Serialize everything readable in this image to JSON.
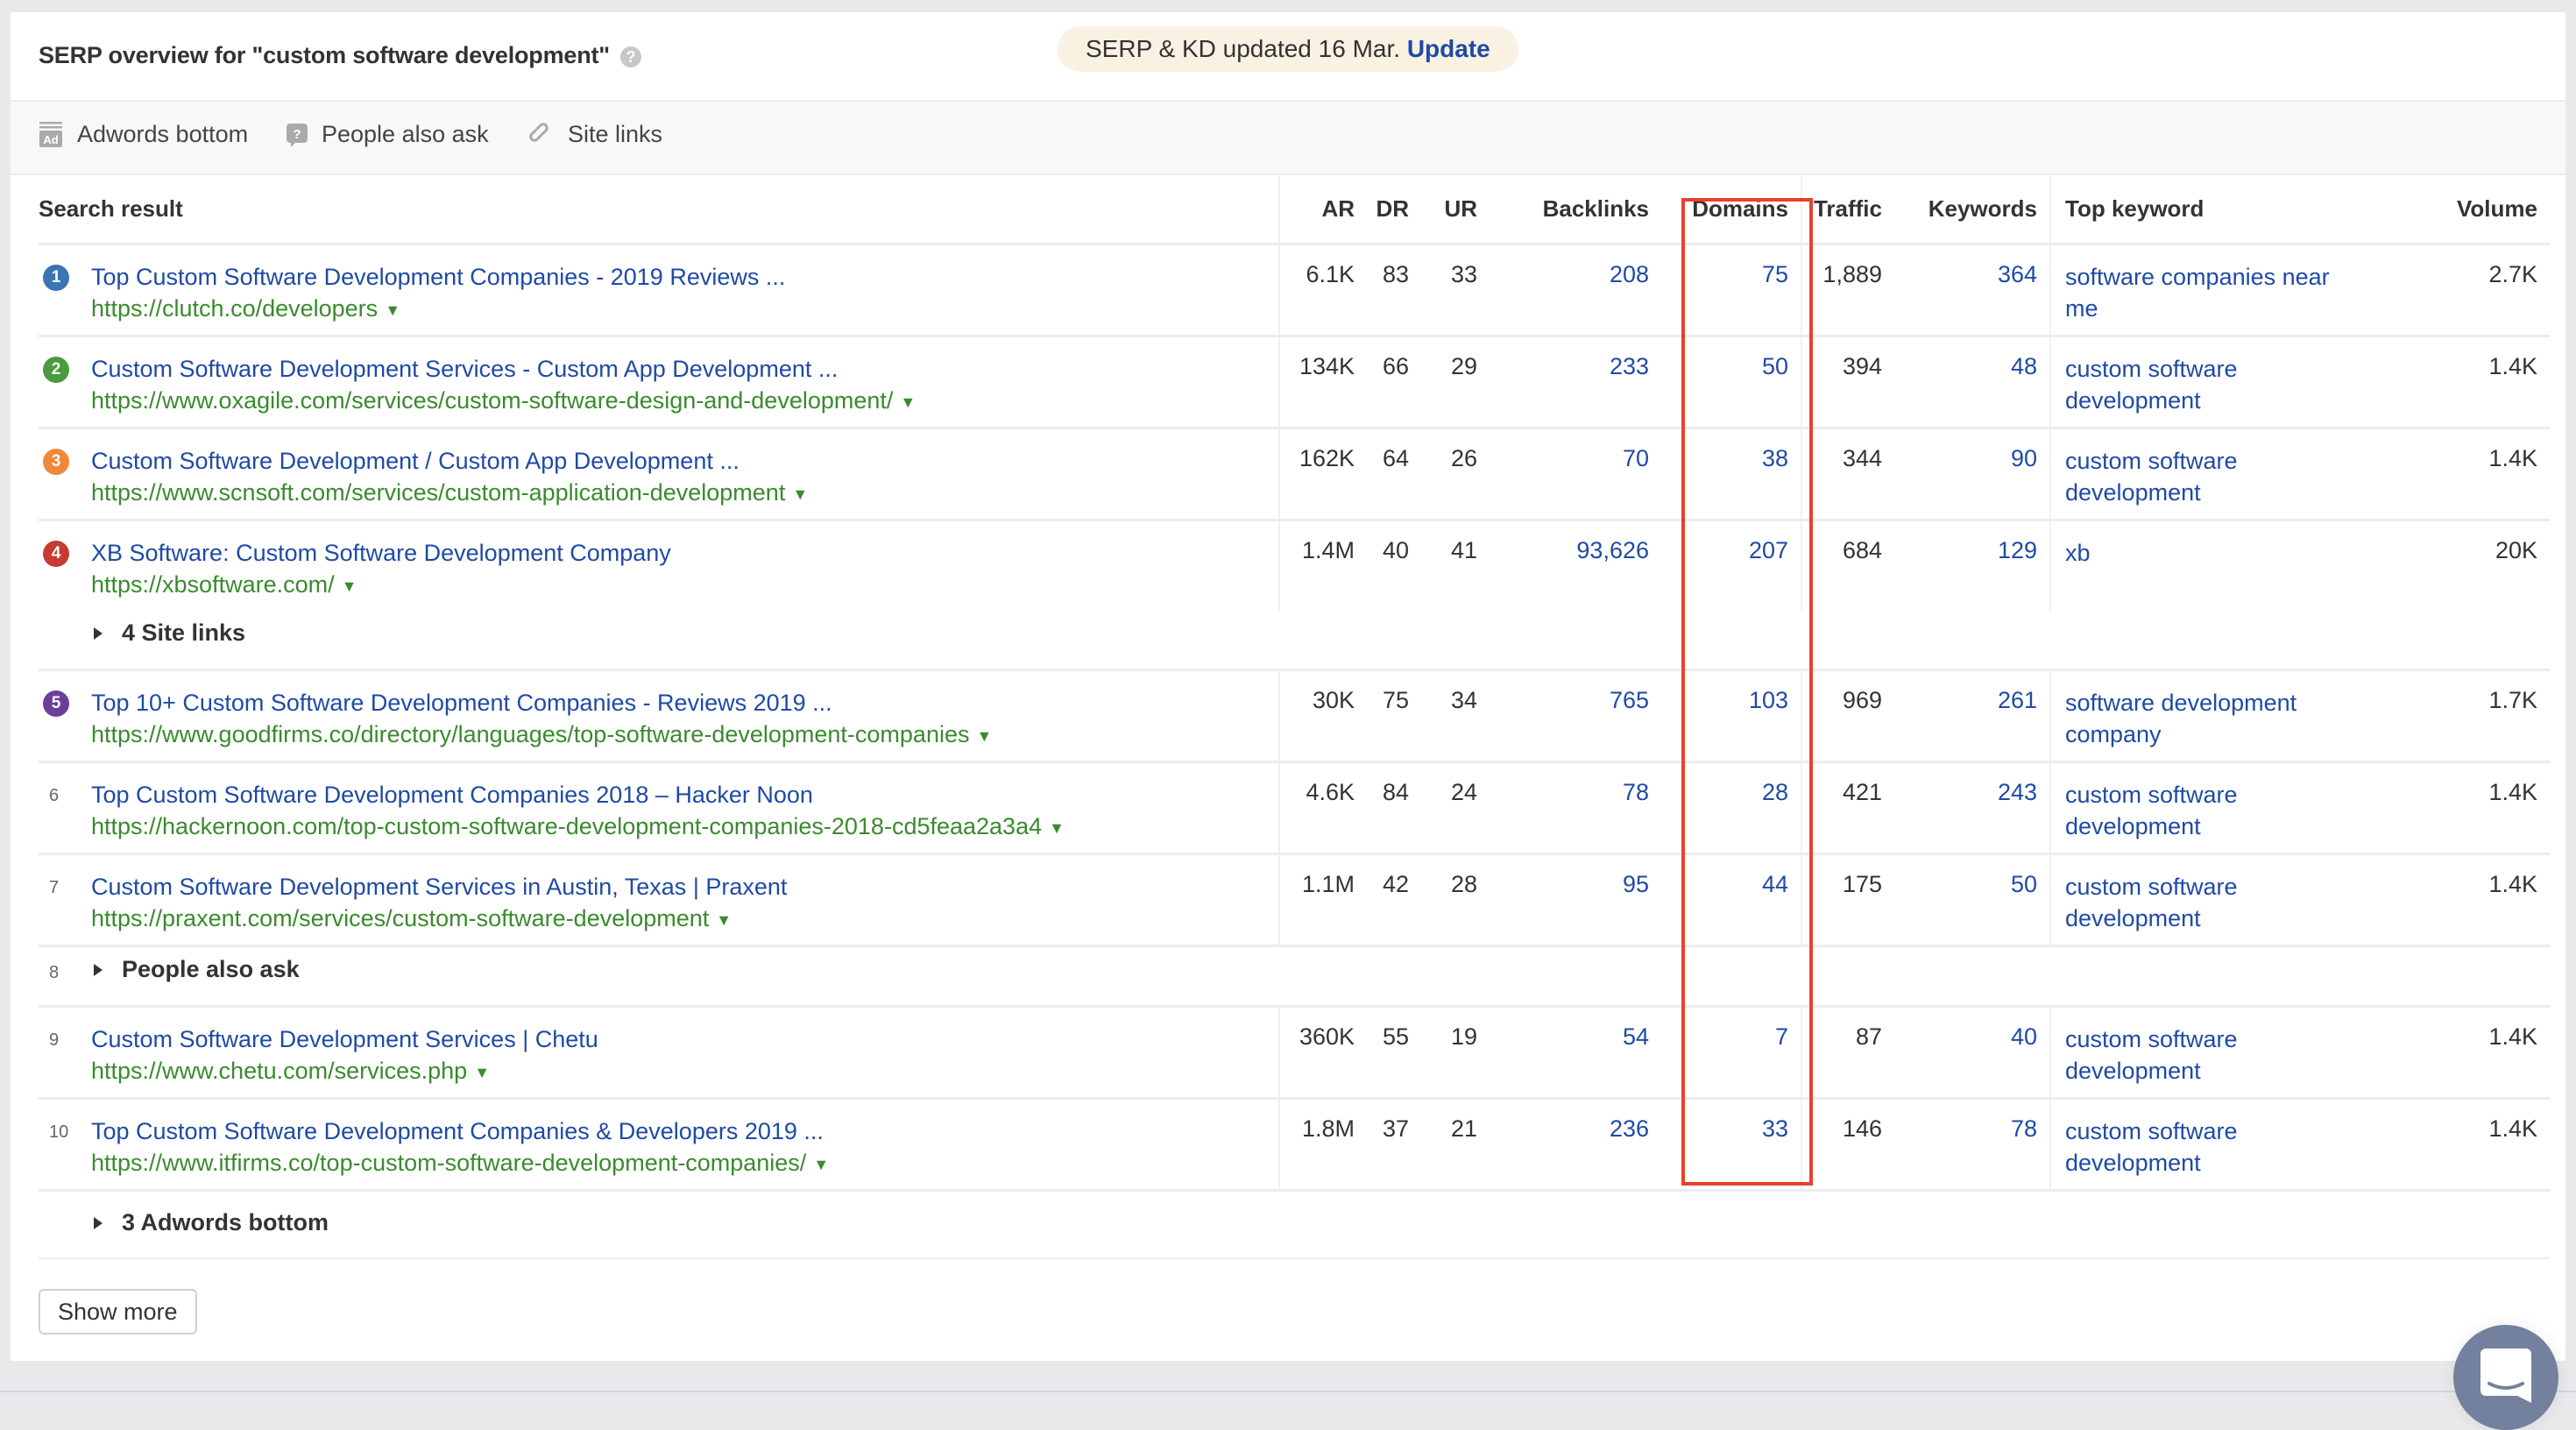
{
  "header": {
    "title": "SERP overview for \"custom software development\"",
    "help_icon": "question-circle-icon",
    "update_notice": "SERP & KD updated 16 Mar.",
    "update_link": "Update"
  },
  "filters": [
    {
      "icon": "ad-icon",
      "label": "Adwords bottom"
    },
    {
      "icon": "question-bubble-icon",
      "label": "People also ask"
    },
    {
      "icon": "link-icon",
      "label": "Site links"
    }
  ],
  "columns": {
    "search_result": "Search result",
    "ar": "AR",
    "dr": "DR",
    "ur": "UR",
    "backlinks": "Backlinks",
    "domains": "Domains",
    "traffic": "Traffic",
    "keywords": "Keywords",
    "top_keyword": "Top keyword",
    "volume": "Volume"
  },
  "rank_colors": {
    "1": "#3a74b4",
    "2": "#4a9a3f",
    "3": "#f0883a",
    "4": "#c73b32",
    "5": "#6a3f9a"
  },
  "rows": [
    {
      "rank": "1",
      "title": "Top Custom Software Development Companies - 2019 Reviews ...",
      "url": "https://clutch.co/developers",
      "ar": "6.1K",
      "dr": "83",
      "ur": "33",
      "backlinks": "208",
      "domains": "75",
      "traffic": "1,889",
      "keywords": "364",
      "top_keyword": "software companies near me",
      "volume": "2.7K"
    },
    {
      "rank": "2",
      "title": "Custom Software Development Services - Custom App Development ...",
      "url": "https://www.oxagile.com/services/custom-software-design-and-development/",
      "ar": "134K",
      "dr": "66",
      "ur": "29",
      "backlinks": "233",
      "domains": "50",
      "traffic": "394",
      "keywords": "48",
      "top_keyword": "custom software development",
      "volume": "1.4K"
    },
    {
      "rank": "3",
      "title": "Custom Software Development / Custom App Development ...",
      "url": "https://www.scnsoft.com/services/custom-application-development",
      "ar": "162K",
      "dr": "64",
      "ur": "26",
      "backlinks": "70",
      "domains": "38",
      "traffic": "344",
      "keywords": "90",
      "top_keyword": "custom software development",
      "volume": "1.4K"
    },
    {
      "rank": "4",
      "title": "XB Software: Custom Software Development Company",
      "url": "https://xbsoftware.com/",
      "ar": "1.4M",
      "dr": "40",
      "ur": "41",
      "backlinks": "93,626",
      "domains": "207",
      "traffic": "684",
      "keywords": "129",
      "top_keyword": "xb",
      "volume": "20K"
    },
    {
      "rank": "5",
      "title": "Top 10+ Custom Software Development Companies - Reviews 2019 ...",
      "url": "https://www.goodfirms.co/directory/languages/top-software-development-companies",
      "ar": "30K",
      "dr": "75",
      "ur": "34",
      "backlinks": "765",
      "domains": "103",
      "traffic": "969",
      "keywords": "261",
      "top_keyword": "software development company",
      "volume": "1.7K"
    },
    {
      "rank": "6",
      "title": "Top Custom Software Development Companies 2018 – Hacker Noon",
      "url": "https://hackernoon.com/top-custom-software-development-companies-2018-cd5feaa2a3a4",
      "ar": "4.6K",
      "dr": "84",
      "ur": "24",
      "backlinks": "78",
      "domains": "28",
      "traffic": "421",
      "keywords": "243",
      "top_keyword": "custom software development",
      "volume": "1.4K"
    },
    {
      "rank": "7",
      "title": "Custom Software Development Services in Austin, Texas | Praxent",
      "url": "https://praxent.com/services/custom-software-development",
      "ar": "1.1M",
      "dr": "42",
      "ur": "28",
      "backlinks": "95",
      "domains": "44",
      "traffic": "175",
      "keywords": "50",
      "top_keyword": "custom software development",
      "volume": "1.4K"
    },
    {
      "rank": "9",
      "title": "Custom Software Development Services | Chetu",
      "url": "https://www.chetu.com/services.php",
      "ar": "360K",
      "dr": "55",
      "ur": "19",
      "backlinks": "54",
      "domains": "7",
      "traffic": "87",
      "keywords": "40",
      "top_keyword": "custom software development",
      "volume": "1.4K"
    },
    {
      "rank": "10",
      "title": "Top Custom Software Development Companies & Developers 2019 ...",
      "url": "https://www.itfirms.co/top-custom-software-development-companies/",
      "ar": "1.8M",
      "dr": "37",
      "ur": "21",
      "backlinks": "236",
      "domains": "33",
      "traffic": "146",
      "keywords": "78",
      "top_keyword": "custom software development",
      "volume": "1.4K"
    }
  ],
  "expanders": {
    "site_links": "4 Site links",
    "people_also_ask_rank": "8",
    "people_also_ask": "People also ask",
    "adwords_bottom": "3 Adwords bottom"
  },
  "footer": {
    "show_more": "Show more"
  },
  "chat": {
    "icon": "chat-bubble-icon"
  },
  "highlight": {
    "column": "Domains",
    "color": "#e8412c"
  }
}
